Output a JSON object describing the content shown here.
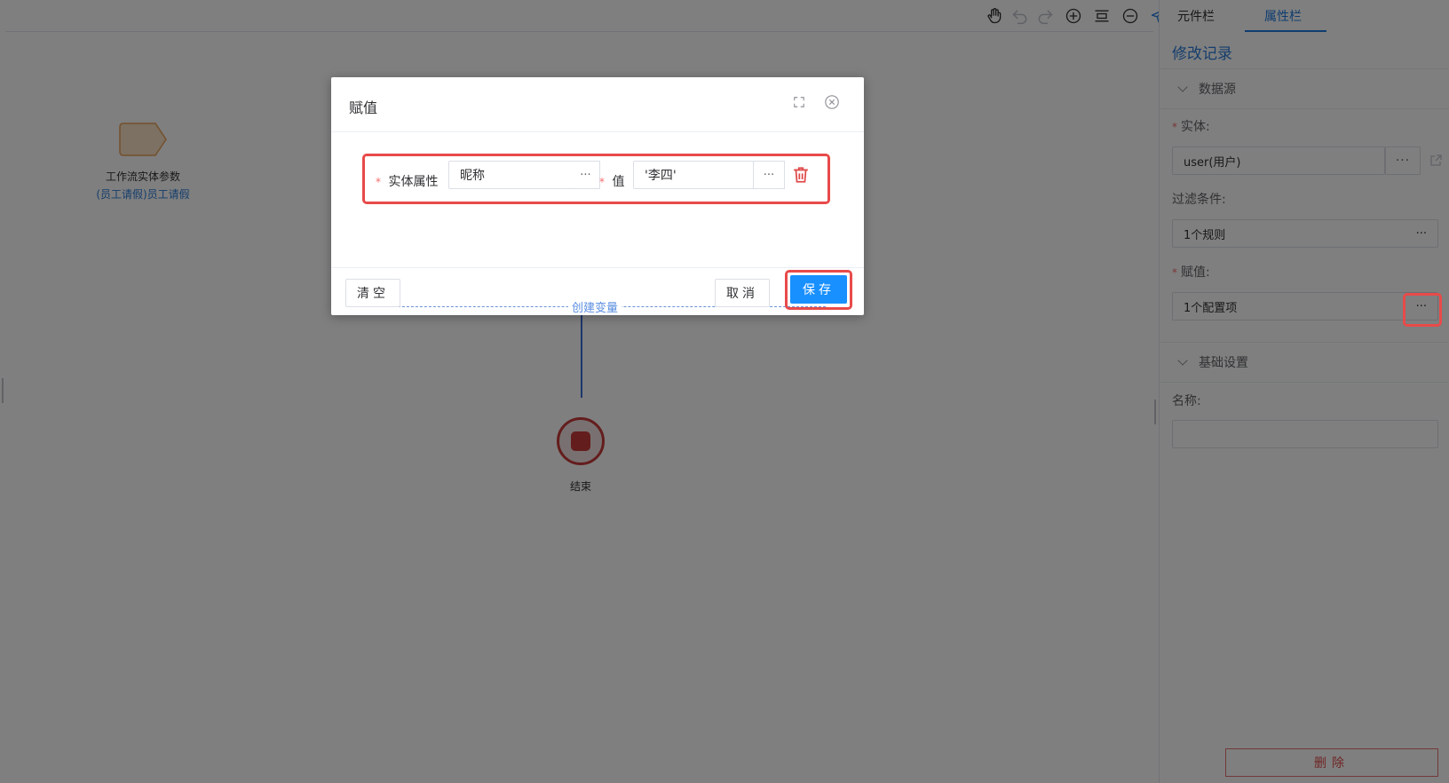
{
  "canvas": {
    "start_node": {
      "label": "工作流实体参数",
      "sub_label": "(员工请假)员工请假"
    },
    "end_node": {
      "label": "结束"
    }
  },
  "panel": {
    "tabs": [
      {
        "label": "元件栏"
      },
      {
        "label": "属性栏"
      }
    ],
    "history_link": "修改记录",
    "data_source": {
      "title": "数据源",
      "entity_label": "实体:",
      "entity_value": "user(用户)",
      "filter_label": "过滤条件:",
      "filter_value": "1个规则",
      "assign_label": "赋值:",
      "assign_value": "1个配置项",
      "more": "···"
    },
    "basic": {
      "title": "基础设置",
      "name_label": "名称:",
      "name_value": ""
    },
    "delete_label": "删除"
  },
  "dialog": {
    "title": "赋值",
    "row": {
      "attr_label": "实体属性",
      "attr_value": "昵称",
      "value_label": "值",
      "value_value": "'李四'",
      "more": "···"
    },
    "create_var": "创建变量",
    "clear_label": "清空",
    "cancel_label": "取消",
    "save_label": "保存"
  },
  "colors": {
    "accent": "#1890ff",
    "highlight": "#e84a4a",
    "link": "#2b7bd9",
    "danger": "#e04b4b"
  },
  "icons": [
    "hand-icon",
    "undo-icon",
    "redo-icon",
    "zoom-in-icon",
    "fit-icon",
    "zoom-out-icon",
    "send-icon",
    "fullscreen-icon",
    "close-icon",
    "trash-icon",
    "external-link-icon",
    "chevron-down-icon"
  ]
}
